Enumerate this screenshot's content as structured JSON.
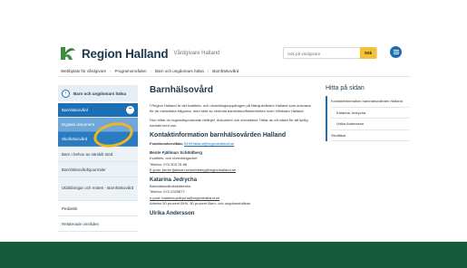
{
  "header": {
    "logo_text": "Region Halland",
    "logo_sub": "Vårdgivare Halland",
    "search_placeholder": "Sök på vardgivare",
    "search_button": "Sök"
  },
  "breadcrumb": [
    "Webbplats för vårdgivare",
    "Programområden",
    "Barn och ungdomars hälsa",
    "Barnhälsovård"
  ],
  "sidebar": {
    "top": "Barn och ungdomars hälsa",
    "active": "Barnhälsovård",
    "subitems": [
      "Digitala dokument",
      "Skolhälsovård"
    ],
    "items": [
      "Barn i behov av särskilt stöd",
      "Barnhälsovårdsjournaler",
      "Utbildningar och möten - Barnhälsovård",
      "Pediatrik",
      "Relaterade områden"
    ]
  },
  "main": {
    "title": "Barnhälsovård",
    "intro1": "I Region Halland är det kvalitets- och utvecklingsuppdragen på Närsjukvården Halland som ansvarar för de metodiska frågorna, med stöd av centrala barnhälsovårdsenheten inom Vårdsam Halland.",
    "intro2": "Hon hittar du regiondisponerade riktlinjer, dokument och checklistor. Hittar du ett nästa för att tydlig kontakt med oss.",
    "contact_heading": "Kontaktinformation barnhälsovården Halland",
    "func_label": "Funktionsbrevlåda:",
    "func_email": "BHVHalland@regionhalland.se",
    "persons": [
      {
        "name": "Bente Fjällman Schöldberg",
        "lines": [
          "Kvalitets- och utvecklingschef",
          "Telefon: 070-303 76 88",
          "E-post: bente.fjallman.schoeldberg@regionhalland.se"
        ]
      },
      {
        "name": "Katarina Jedrycha",
        "lines": [
          "Barnhälsovårdssköterska",
          "Telefon: 070-2329877",
          "e-post: katarina.jedrycha@regionhalland.se",
          "Arbetar 50 procent BHV, 50 procent Barn- och ungdomshälsan"
        ]
      }
    ],
    "name3": "Ulrika Andersson"
  },
  "aside": {
    "title": "Hitta på sidan",
    "items": [
      "Kontaktinformation barnhälsovården Halland",
      "Katarina Jedrycha",
      "Ulrika Andersson",
      "Skolläkar"
    ]
  },
  "colors": {
    "brand_blue": "#1c6fb5",
    "footer_green": "#165a3c",
    "search_yellow": "#f2c230",
    "annotation": "#f2b71f"
  }
}
